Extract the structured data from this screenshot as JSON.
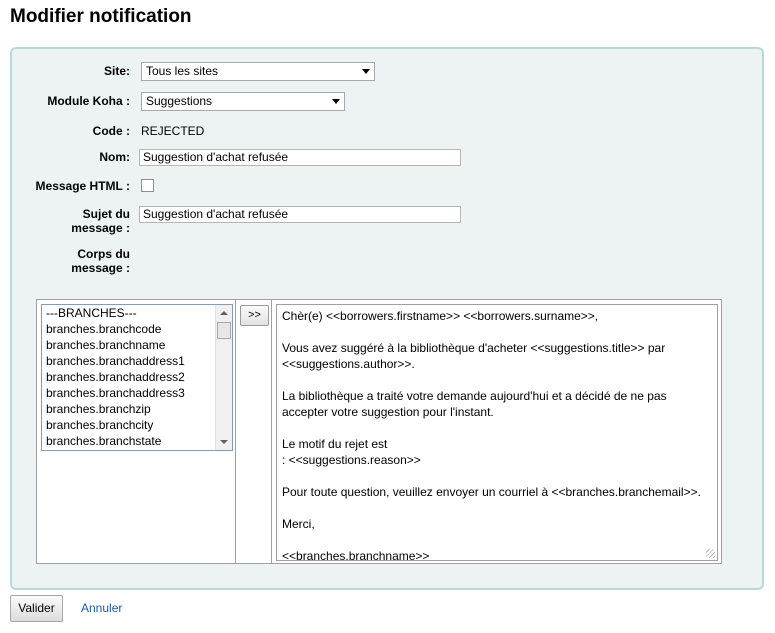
{
  "page": {
    "title": "Modifier notification"
  },
  "form": {
    "site": {
      "label": "Site:",
      "value": "Tous les sites"
    },
    "module": {
      "label": "Module Koha :",
      "value": "Suggestions"
    },
    "code": {
      "label": "Code :",
      "value": "REJECTED"
    },
    "name": {
      "label": "Nom:",
      "value": "Suggestion d'achat refusée"
    },
    "html_message": {
      "label": "Message HTML :",
      "checked": false
    },
    "subject": {
      "label_line1": "Sujet du",
      "label_line2": "message :",
      "value": "Suggestion d'achat refusée"
    },
    "body": {
      "label_line1": "Corps du",
      "label_line2": "message :"
    }
  },
  "fields_list": [
    "---BRANCHES---",
    "branches.branchcode",
    "branches.branchname",
    "branches.branchaddress1",
    "branches.branchaddress2",
    "branches.branchaddress3",
    "branches.branchzip",
    "branches.branchcity",
    "branches.branchstate"
  ],
  "insert_button": {
    "label": ">>"
  },
  "message_body": [
    "Chèr(e) <<borrowers.firstname>> <<borrowers.surname>>,",
    "",
    "Vous avez suggéré à la bibliothèque d'acheter <<suggestions.title>> par",
    "<<suggestions.author>>.",
    "",
    "La bibliothèque a traité votre demande aujourd'hui et a décidé de ne pas",
    "accepter votre suggestion pour l'instant.",
    "",
    "Le motif du rejet est",
    ": <<suggestions.reason>>",
    "",
    "Pour toute question, veuillez envoyer un courriel à <<branches.branchemail>>.",
    "",
    "Merci,",
    "",
    "<<branches.branchname>>"
  ],
  "actions": {
    "submit_label": "Valider",
    "cancel_label": "Annuler"
  },
  "colors": {
    "panel_bg": "#edf3f3",
    "panel_border": "#b9d8d9",
    "link": "#1f5aa6"
  }
}
